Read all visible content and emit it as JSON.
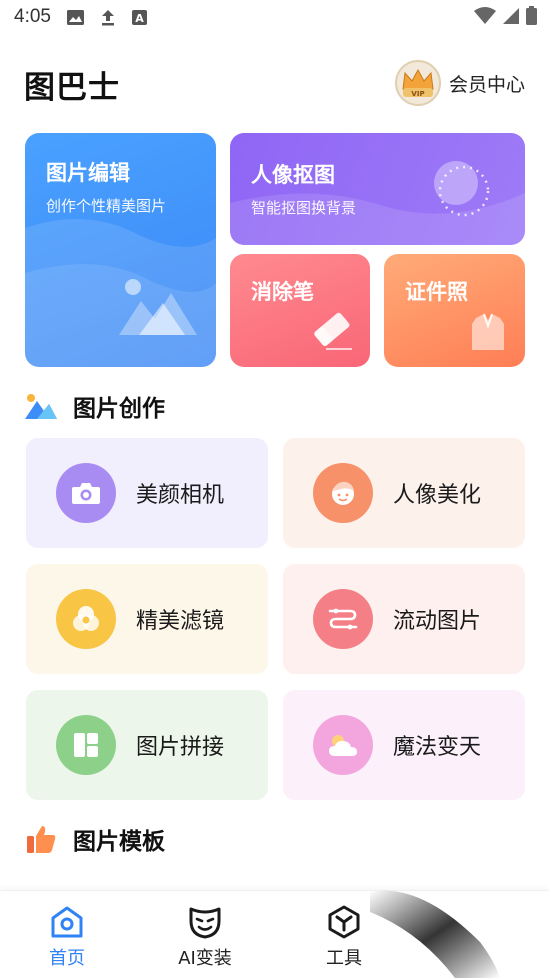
{
  "status_bar": {
    "time": "4:05",
    "icons": [
      "image-notification-icon",
      "upload-icon",
      "font-app-icon",
      "wifi-icon",
      "signal-icon",
      "battery-icon"
    ]
  },
  "header": {
    "app_title": "图巴士",
    "vip_badge": "VIP",
    "member_center": "会员中心"
  },
  "features": {
    "photo_edit": {
      "title": "图片编辑",
      "subtitle": "创作个性精美图片"
    },
    "portrait_cutout": {
      "title": "人像抠图",
      "subtitle": "智能抠图换背景"
    },
    "eraser": {
      "title": "消除笔"
    },
    "id_photo": {
      "title": "证件照"
    }
  },
  "sections": {
    "creation": "图片创作",
    "templates": "图片模板"
  },
  "tools": [
    {
      "label": "美颜相机",
      "icon": "camera-icon",
      "bg": "#f1eefd",
      "icon_bg": "#a98cf2"
    },
    {
      "label": "人像美化",
      "icon": "face-icon",
      "bg": "#fdf1ec",
      "icon_bg": "#f6916a"
    },
    {
      "label": "精美滤镜",
      "icon": "filter-icon",
      "bg": "#fdf7e9",
      "icon_bg": "#f8c545"
    },
    {
      "label": "流动图片",
      "icon": "flow-icon",
      "bg": "#fdf0ef",
      "icon_bg": "#f47f86"
    },
    {
      "label": "图片拼接",
      "icon": "collage-icon",
      "bg": "#edf6ea",
      "icon_bg": "#8cd08a"
    },
    {
      "label": "魔法变天",
      "icon": "weather-icon",
      "bg": "#fcf0fa",
      "icon_bg": "#f3a6de"
    }
  ],
  "bottom_nav": [
    {
      "label": "首页",
      "icon": "home-icon",
      "active": true
    },
    {
      "label": "AI变装",
      "icon": "mask-icon",
      "active": false
    },
    {
      "label": "工具",
      "icon": "cube-icon",
      "active": false
    }
  ],
  "colors": {
    "accent": "#2f83f5",
    "edit_card": "#3a8bf7",
    "portrait_card": "#9470f6",
    "eraser_card": "#fa7080",
    "id_card": "#ff8a5c"
  }
}
